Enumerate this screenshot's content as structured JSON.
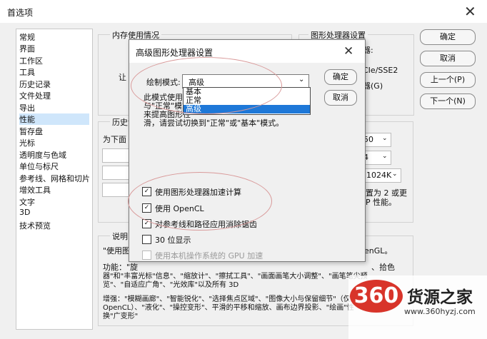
{
  "window": {
    "title": "首选项"
  },
  "sidebar": {
    "items": [
      "常规",
      "界面",
      "工作区",
      "工具",
      "历史记录",
      "文件处理",
      "导出",
      "性能",
      "暂存盘",
      "光标",
      "透明度与色域",
      "单位与标尺",
      "参考线、网格和切片",
      "增效工具",
      "文字",
      "3D",
      "技术预览"
    ],
    "selected": 7
  },
  "buttons": {
    "ok": "确定",
    "cancel": "取消",
    "prev": "上一个(P)",
    "next": "下一个(N)"
  },
  "groups": {
    "memory": "内存使用情况",
    "gpu": "图形处理器设置",
    "history": "历史记",
    "desc": "说明"
  },
  "background": {
    "mem_let": "让",
    "gpu_partial1": "器:",
    "gpu_partial2": "CIe/SSE2",
    "gpu_partial3": "器(G)",
    "history_below": "为下面",
    "val_50": "50",
    "val_4": "4",
    "val_1024": "1024K",
    "right_text1": "置为 2 或更",
    "right_text2": "P 性能。",
    "desc_line1": "\"使用图",
    "desc_line1_r": "enGL。",
    "desc_line2": "功能：\"旋",
    "desc_line2_r": "、拾色",
    "desc_line3": "器\"和\"丰富光标\"信息\"、\"缩放计\"、\"擦拭工具\"、\"画面画笔大小调整\"、\"画笔笔尖预",
    "desc_line4": "览\"、\"自适应广角\"、\"光效库\"以及所有 3D",
    "desc_line5": "增强：\"模糊画廊\"、\"智能锐化\"、\"选择焦点区域\"、\"图像大小与保留细节\"（仅用于",
    "desc_line6": "OpenCL）、\"液化\"、\"操控变形\"、平滑的平移和缩放、画布边界投影、\"绘画\"性",
    "desc_line7": "换\"广变形\""
  },
  "dialog": {
    "title": "高级图形处理器设置",
    "mode_label": "绘制模式:",
    "mode_value": "高级",
    "ok": "确定",
    "cancel": "取消",
    "dropdown_options": [
      "基本",
      "正常",
      "高级"
    ],
    "text1": "此模式使用图",
    "text2": "与\"正常\"模式",
    "text3": "来提高图形性",
    "text4": "滑，请尝试切换到\"正常\"或\"基本\"模式。",
    "cb1": "使用图形处理器加速计算",
    "cb2": "使用 OpenCL",
    "cb3": "对参考线和路径应用消除锯齿",
    "cb4": "30 位显示",
    "cb5": "使用本机操作系统的 GPU 加速"
  },
  "watermark": {
    "logo": "360",
    "name": "货源之家",
    "url": "www.360hyzj.com"
  }
}
